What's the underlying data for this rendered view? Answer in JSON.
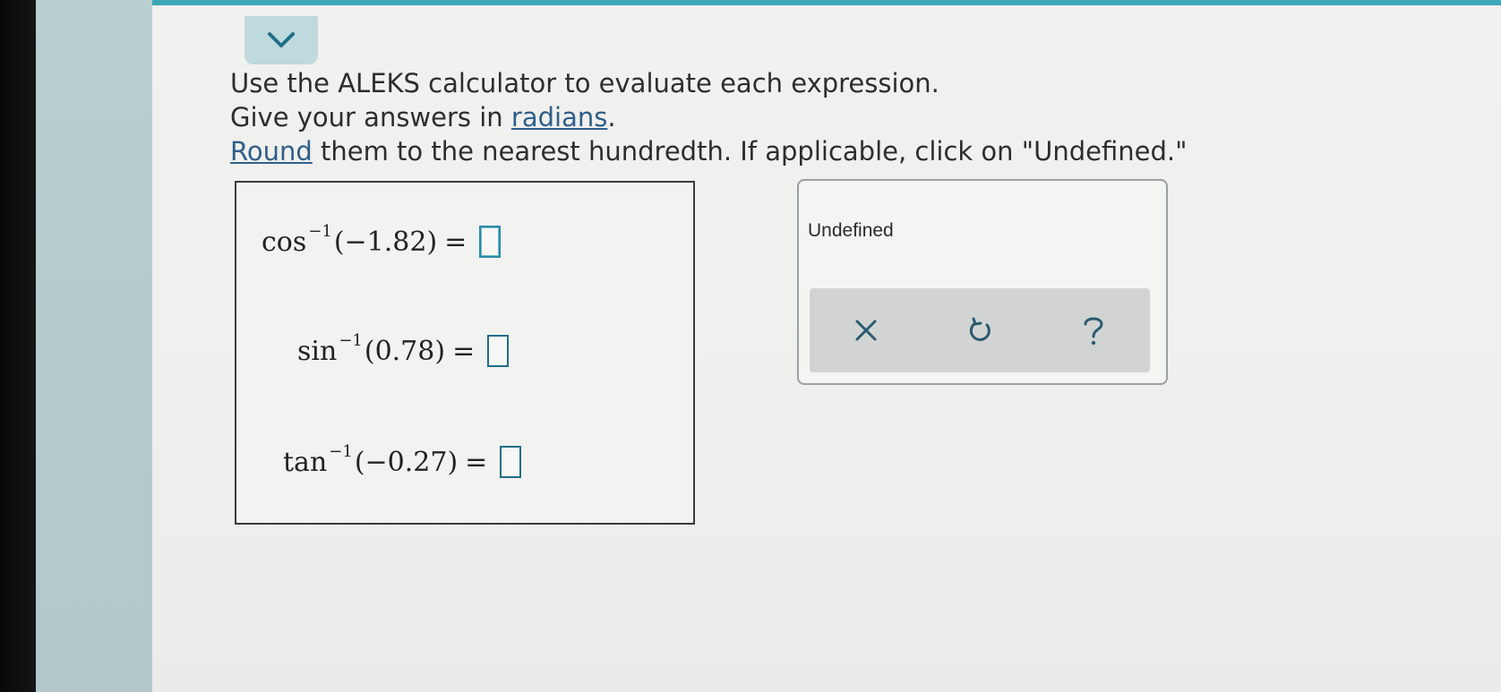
{
  "instructions": {
    "line1": "Use the ALEKS calculator to evaluate each expression.",
    "line2_prefix": "Give your answers in ",
    "line2_link": "radians",
    "line2_suffix": ".",
    "line3_link": "Round",
    "line3_suffix": " them to the nearest hundredth. If applicable, click on \"Undefined.\""
  },
  "problems": [
    {
      "func": "cos",
      "exp": "−1",
      "arg": "(−1.82)",
      "eq": "=",
      "answer": ""
    },
    {
      "func": "sin",
      "exp": "−1",
      "arg": "(0.78)",
      "eq": "=",
      "answer": ""
    },
    {
      "func": "tan",
      "exp": "−1",
      "arg": "(−0.27)",
      "eq": "=",
      "answer": ""
    }
  ],
  "tools": {
    "undefined_label": "Undefined",
    "clear_icon": "x-icon",
    "undo_icon": "undo-icon",
    "help_icon": "help-icon"
  },
  "colors": {
    "accent": "#3ea6b8",
    "link": "#2f5f8a",
    "answer_box": "#1d6e86"
  }
}
